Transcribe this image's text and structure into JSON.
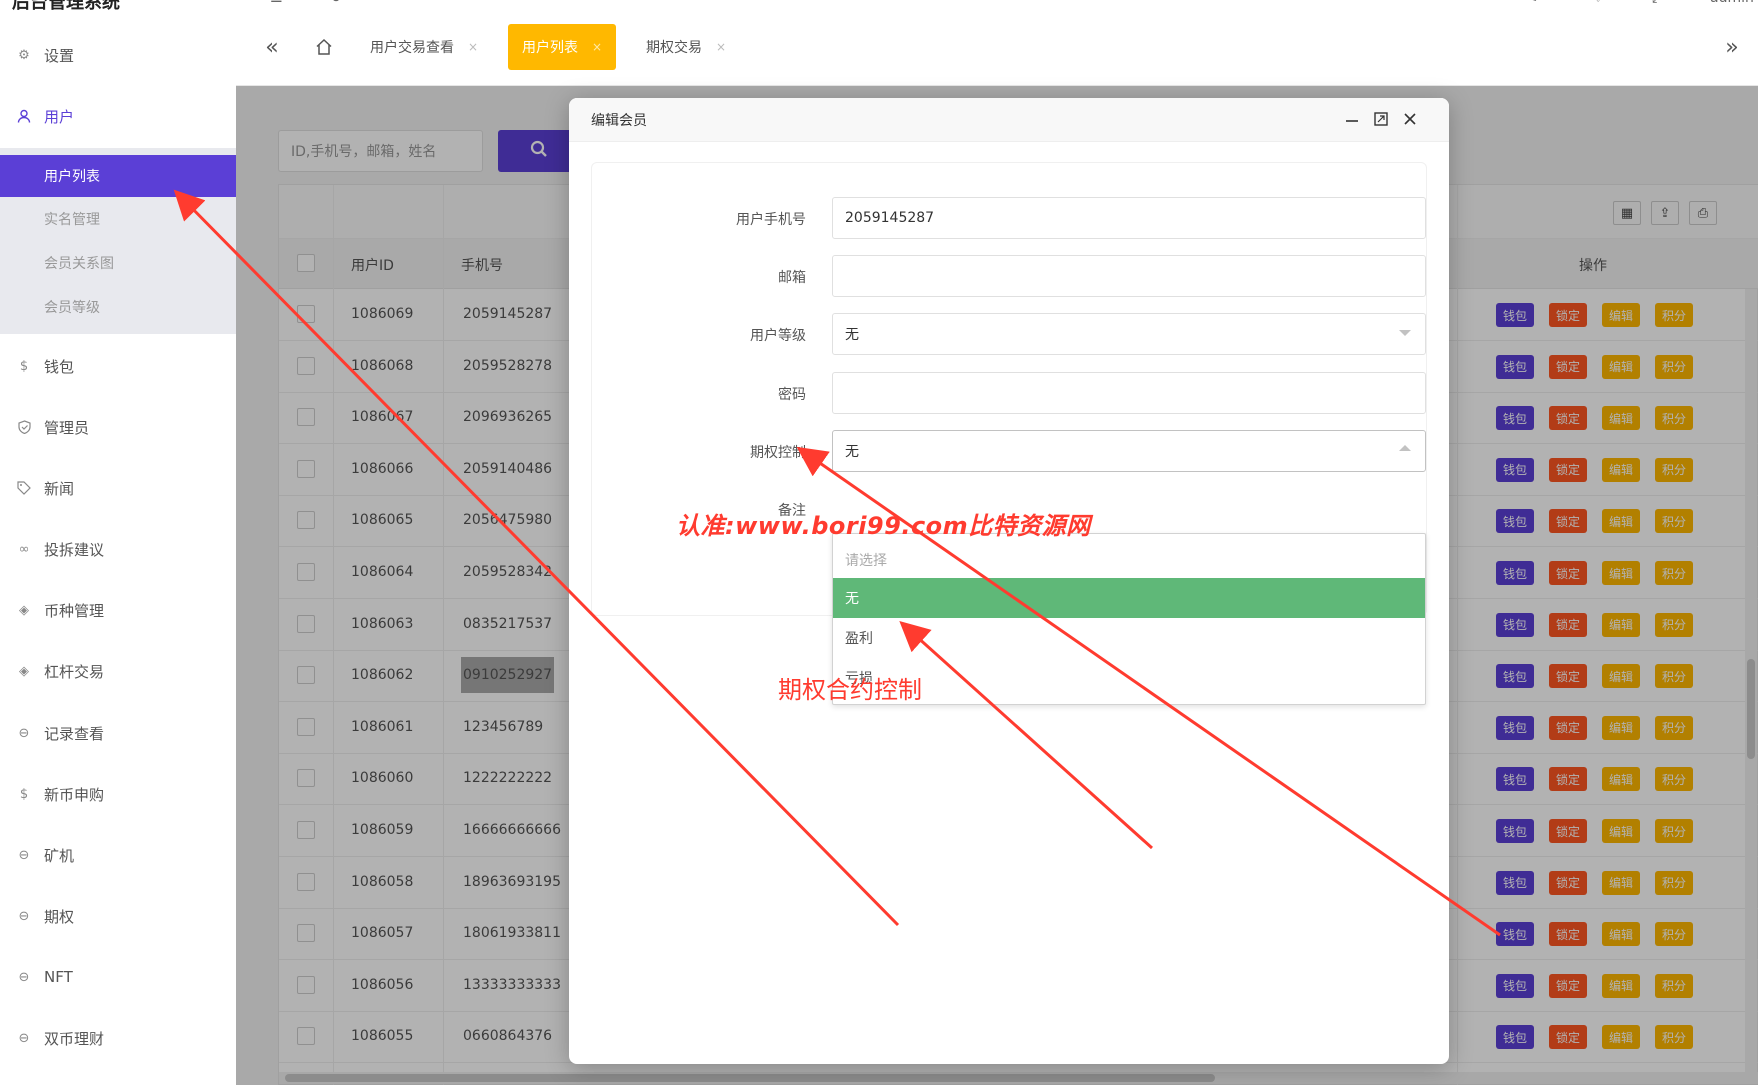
{
  "app": {
    "title": "后台管理系统"
  },
  "header": {
    "icons": [
      "collapse-icon",
      "refresh-icon",
      "theme-icon",
      "favorite-icon",
      "fullscreen-icon"
    ],
    "user": "admin"
  },
  "tabs": {
    "nav_back": "«",
    "nav_forward": "»",
    "items": [
      {
        "label": "用户交易查看",
        "active": false
      },
      {
        "label": "用户列表",
        "active": true
      },
      {
        "label": "期权交易",
        "active": false
      }
    ],
    "close_glyph": "×"
  },
  "sidebar": {
    "items": [
      {
        "label": "设置",
        "icon": "gear-icon"
      },
      {
        "label": "用户",
        "icon": "user-icon",
        "active": true
      },
      {
        "label": "钱包",
        "icon": "coin-icon"
      },
      {
        "label": "管理员",
        "icon": "shield-icon"
      },
      {
        "label": "新闻",
        "icon": "tag-icon"
      },
      {
        "label": "投拆建议",
        "icon": "link-icon"
      },
      {
        "label": "币种管理",
        "icon": "diamond-icon"
      },
      {
        "label": "杠杆交易",
        "icon": "diamond-icon"
      },
      {
        "label": "记录查看",
        "icon": "record-icon"
      },
      {
        "label": "新币申购",
        "icon": "coin-icon"
      },
      {
        "label": "矿机",
        "icon": "record-icon"
      },
      {
        "label": "期权",
        "icon": "record-icon"
      },
      {
        "label": "NFT",
        "icon": "record-icon"
      },
      {
        "label": "双币理财",
        "icon": "record-icon"
      }
    ],
    "subitems": [
      {
        "label": "用户列表",
        "selected": true
      },
      {
        "label": "实名管理",
        "selected": false
      },
      {
        "label": "会员关系图",
        "selected": false
      },
      {
        "label": "会员等级",
        "selected": false
      }
    ]
  },
  "search": {
    "placeholder": "ID,手机号，邮箱，姓名",
    "button_icon": "search-icon"
  },
  "table": {
    "toolbar_icons": [
      "columns-icon",
      "export-icon",
      "print-icon"
    ],
    "columns": {
      "id": "用户ID",
      "phone": "手机号",
      "ops": "操作"
    },
    "op_labels": {
      "wallet": "钱包",
      "lock": "锁定",
      "edit": "编辑",
      "points": "积分"
    },
    "rows": [
      {
        "id": "1086069",
        "phone": "2059145287"
      },
      {
        "id": "1086068",
        "phone": "2059528278"
      },
      {
        "id": "1086067",
        "phone": "2096936265"
      },
      {
        "id": "1086066",
        "phone": "2059140486"
      },
      {
        "id": "1086065",
        "phone": "2056475980"
      },
      {
        "id": "1086064",
        "phone": "2059528342"
      },
      {
        "id": "1086063",
        "phone": "0835217537"
      },
      {
        "id": "1086062",
        "phone": "0910252927",
        "highlight": true
      },
      {
        "id": "1086061",
        "phone": "123456789"
      },
      {
        "id": "1086060",
        "phone": "1222222222"
      },
      {
        "id": "1086059",
        "phone": "16666666666"
      },
      {
        "id": "1086058",
        "phone": "18963693195"
      },
      {
        "id": "1086057",
        "phone": "18061933811"
      },
      {
        "id": "1086056",
        "phone": "13333333333"
      },
      {
        "id": "1086055",
        "phone": "0660864376"
      }
    ]
  },
  "modal": {
    "title": "编辑会员",
    "controls": [
      "minimize-icon",
      "maximize-icon",
      "close-icon"
    ],
    "fields": {
      "phone": {
        "label": "用户手机号",
        "value": "2059145287"
      },
      "email": {
        "label": "邮箱",
        "value": ""
      },
      "level": {
        "label": "用户等级",
        "value": "无"
      },
      "password": {
        "label": "密码",
        "value": ""
      },
      "option_control": {
        "label": "期权控制",
        "value": "无"
      },
      "remark": {
        "label": "备注"
      }
    },
    "dropdown": {
      "placeholder": "请选择",
      "options": [
        "无",
        "盈利",
        "亏损"
      ],
      "selected": "无"
    }
  },
  "annotations": {
    "watermark": "认准:www.bori99.com比特资源网",
    "label": "期权合约控制",
    "color": "#ff3b2f"
  },
  "colors": {
    "primary": "#5b3fd6",
    "warning": "#ffb800",
    "danger": "#ff5722",
    "success": "#5fb878"
  }
}
